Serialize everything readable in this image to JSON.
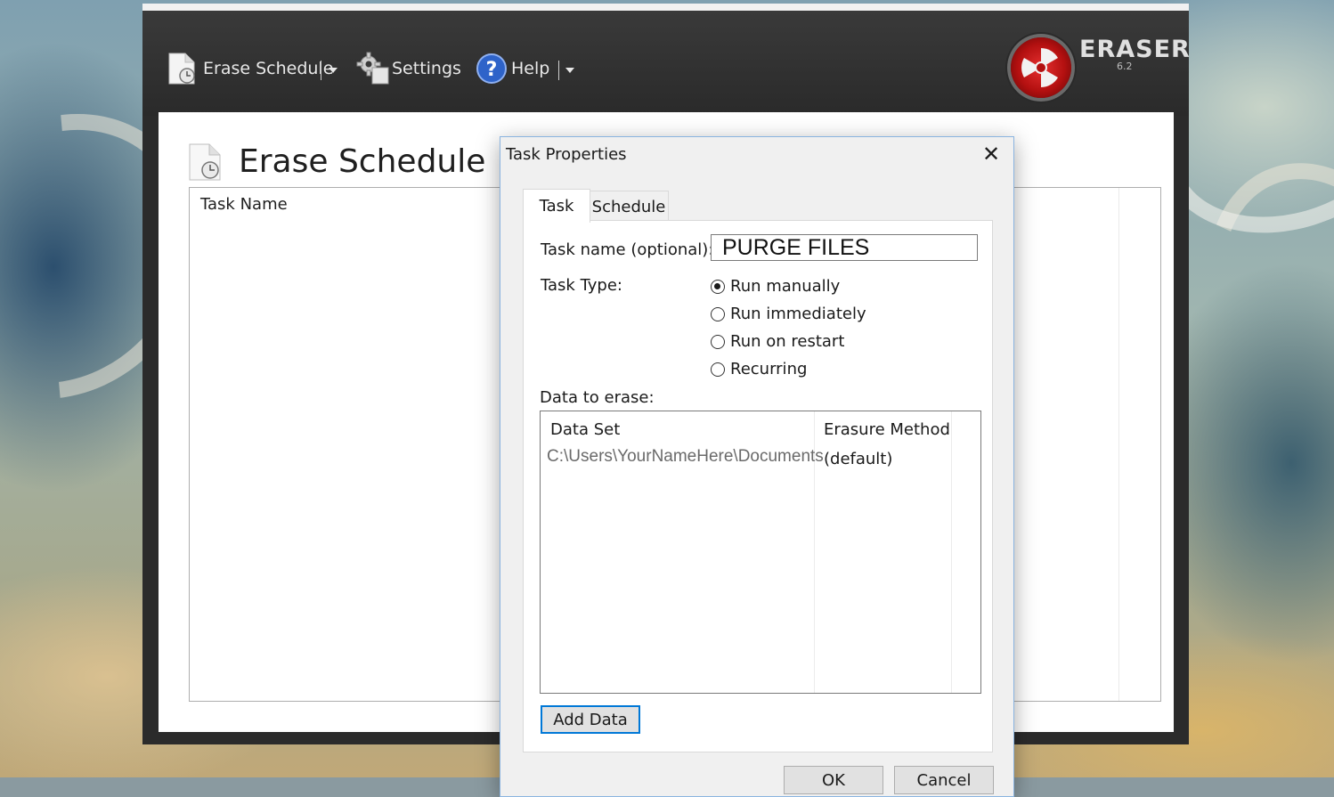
{
  "toolbar": {
    "erase_schedule": "Erase Schedule",
    "settings": "Settings",
    "help": "Help"
  },
  "brand": {
    "name": "ERASER",
    "version": "6.2"
  },
  "main": {
    "title": "Erase Schedule",
    "columns": [
      "Task Name"
    ]
  },
  "dialog": {
    "title": "Task Properties",
    "tabs": [
      {
        "label": "Task",
        "active": true
      },
      {
        "label": "Schedule",
        "active": false
      }
    ],
    "task_name_label": "Task name (optional):",
    "task_name_value": "PURGE FILES",
    "task_type_label": "Task Type:",
    "task_types": [
      {
        "label": "Run manually",
        "selected": true
      },
      {
        "label": "Run immediately",
        "selected": false
      },
      {
        "label": "Run on restart",
        "selected": false
      },
      {
        "label": "Recurring",
        "selected": false
      }
    ],
    "data_label": "Data to erase:",
    "data_columns": [
      "Data Set",
      "Erasure Method"
    ],
    "data_rows": [
      {
        "data_set": "C:\\Users\\YourNameHere\\Documents",
        "method": "(default)"
      }
    ],
    "add_data": "Add Data",
    "ok": "OK",
    "cancel": "Cancel"
  },
  "colors": {
    "accent": "#0078d7",
    "toolbar": "#2b2b2b",
    "logo_red": "#c81818"
  },
  "icons": [
    "erase-schedule-icon",
    "settings-gear-icon",
    "help-icon",
    "eraser-logo-icon",
    "close-icon",
    "dropdown-arrow-icon"
  ]
}
